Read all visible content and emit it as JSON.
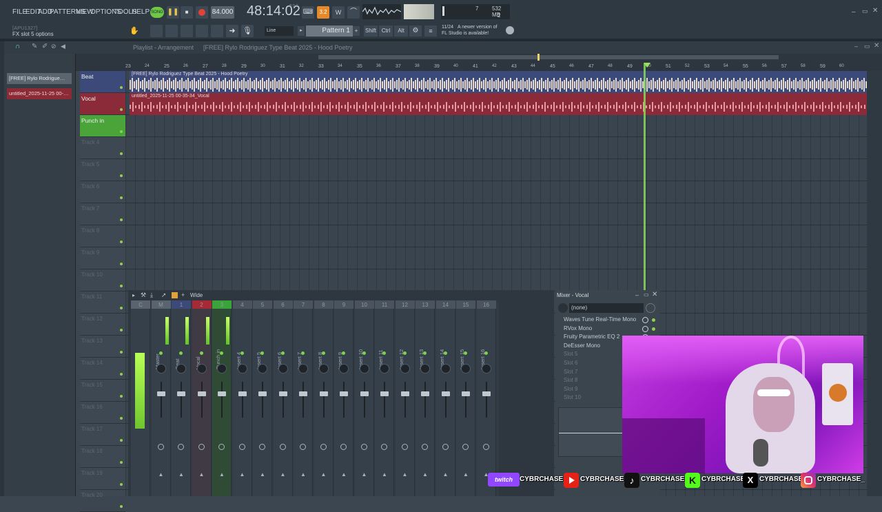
{
  "menu": [
    "FILE",
    "EDIT",
    "ADD",
    "PATTERNS",
    "VIEW",
    "OPTIONS",
    "TOOLS",
    "HELP"
  ],
  "transport": {
    "song_label": "SONG",
    "tempo": "84.000",
    "time": "48:14:02",
    "time_suffix": "B:S:T"
  },
  "cpu": {
    "value1": "7",
    "ram": "532 MB",
    "value2": "2"
  },
  "hint": {
    "line1": "[APU1327]",
    "line2": "FX slot 5 options"
  },
  "snap": {
    "label": "Line"
  },
  "pattern": {
    "label": "Pattern 1"
  },
  "modifiers": [
    "Shift",
    "Ctrl",
    "Alt"
  ],
  "notice": {
    "counter": "11/24",
    "text1": "A newer version of",
    "text2": "FL Studio is available!"
  },
  "playlist": {
    "title": "Playlist - Arrangement",
    "breadcrumb": "[FREE] Rylo Rodriguez Type Beat 2025 - Hood Poetry"
  },
  "browser": {
    "items": [
      "[FREE] Rylo Rodrigue…",
      "untitled_2025-11-25 00-…"
    ]
  },
  "ruler": [
    "23",
    "24",
    "25",
    "26",
    "27",
    "28",
    "29",
    "30",
    "31",
    "32",
    "33",
    "34",
    "35",
    "36",
    "37",
    "38",
    "39",
    "40",
    "41",
    "42",
    "43",
    "44",
    "45",
    "46",
    "47",
    "48",
    "49",
    "50",
    "51",
    "52",
    "53",
    "54",
    "55",
    "56",
    "57",
    "58",
    "59",
    "60"
  ],
  "tracks": [
    {
      "name": "Beat",
      "clip": "[FREE] Rylo Rodriguez Type Beat 2025 - Hood Poetry"
    },
    {
      "name": "Vocal",
      "clip": "untitled_2025-11-25 00-35-34_Vocal"
    },
    {
      "name": "Punch in",
      "clip": ""
    },
    {
      "name": "Track 4"
    },
    {
      "name": "Track 5"
    },
    {
      "name": "Track 6"
    },
    {
      "name": "Track 7"
    },
    {
      "name": "Track 8"
    },
    {
      "name": "Track 9"
    },
    {
      "name": "Track 10"
    },
    {
      "name": "Track 11"
    },
    {
      "name": "Track 12"
    },
    {
      "name": "Track 13"
    },
    {
      "name": "Track 14"
    },
    {
      "name": "Track 15"
    },
    {
      "name": "Track 16"
    },
    {
      "name": "Track 17"
    },
    {
      "name": "Track 18"
    },
    {
      "name": "Track 19"
    },
    {
      "name": "Track 20"
    }
  ],
  "mixer": {
    "view": "Wide",
    "strips": [
      {
        "num": "C",
        "label": ""
      },
      {
        "num": "M",
        "label": "Master"
      },
      {
        "num": "1",
        "label": "Beat"
      },
      {
        "num": "2",
        "label": "Vocal"
      },
      {
        "num": "3",
        "label": "Punch in"
      },
      {
        "num": "4",
        "label": "Insert 4"
      },
      {
        "num": "5",
        "label": "Insert 5"
      },
      {
        "num": "6",
        "label": "Insert 6"
      },
      {
        "num": "7",
        "label": "Insert 7"
      },
      {
        "num": "8",
        "label": "Insert 8"
      },
      {
        "num": "9",
        "label": "Insert 9"
      },
      {
        "num": "10",
        "label": "Insert 10"
      },
      {
        "num": "11",
        "label": "Insert 11"
      },
      {
        "num": "12",
        "label": "Insert 12"
      },
      {
        "num": "13",
        "label": "Insert 13"
      },
      {
        "num": "14",
        "label": "Insert 14"
      },
      {
        "num": "15",
        "label": "Insert 15"
      },
      {
        "num": "16",
        "label": "Insert 16"
      }
    ]
  },
  "mixer_panel": {
    "title": "Mixer - Vocal",
    "preset": "(none)",
    "slots": [
      "Waves Tune Real-Time Mono",
      "RVox Mono",
      "Fruity Parametric EQ 2",
      "DeEsser Mono",
      "Slot 5",
      "Slot 6",
      "Slot 7",
      "Slot 8",
      "Slot 9",
      "Slot 10"
    ]
  },
  "overlay": {
    "twitch": "twitch",
    "handles": [
      "CYBRCHASE_",
      "CYBRCHASE_",
      "CYBRCHASE_",
      "CYBRCHASE_",
      "CYBRCHASE_",
      "CYBRCHASE_"
    ]
  }
}
